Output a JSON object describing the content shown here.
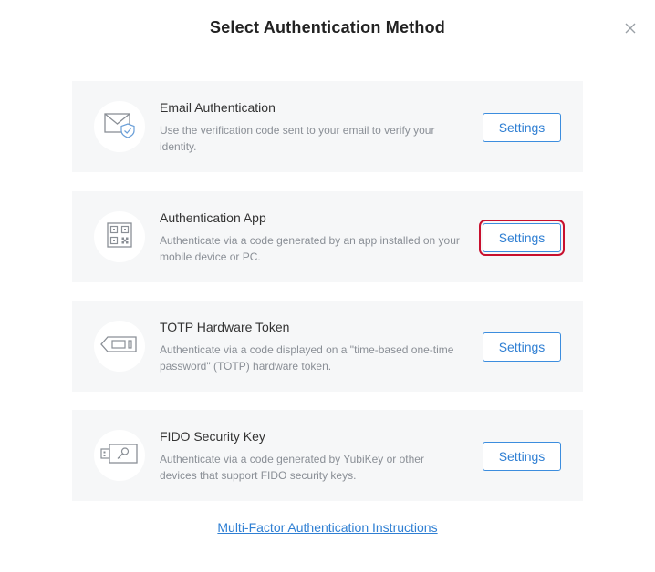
{
  "dialog": {
    "title": "Select Authentication Method",
    "close_icon": "close-icon"
  },
  "methods": [
    {
      "title": "Email Authentication",
      "description": "Use the verification code sent to your email to verify your identity.",
      "button": "Settings",
      "icon": "email-shield-icon"
    },
    {
      "title": "Authentication App",
      "description": "Authenticate via a code generated by an app installed on your mobile device or PC.",
      "button": "Settings",
      "icon": "qr-code-icon"
    },
    {
      "title": "TOTP Hardware Token",
      "description": "Authenticate via a code displayed on a \"time-based one-time password\" (TOTP) hardware token.",
      "button": "Settings",
      "icon": "hardware-token-icon"
    },
    {
      "title": "FIDO Security Key",
      "description": "Authenticate via a code generated by YubiKey or other devices that support FIDO security keys.",
      "button": "Settings",
      "icon": "security-key-icon"
    }
  ],
  "footer": {
    "link": "Multi-Factor Authentication Instructions"
  },
  "colors": {
    "accent": "#2f7fd3",
    "card_background": "#f6f7f8",
    "focus_outline": "#c8102e"
  }
}
